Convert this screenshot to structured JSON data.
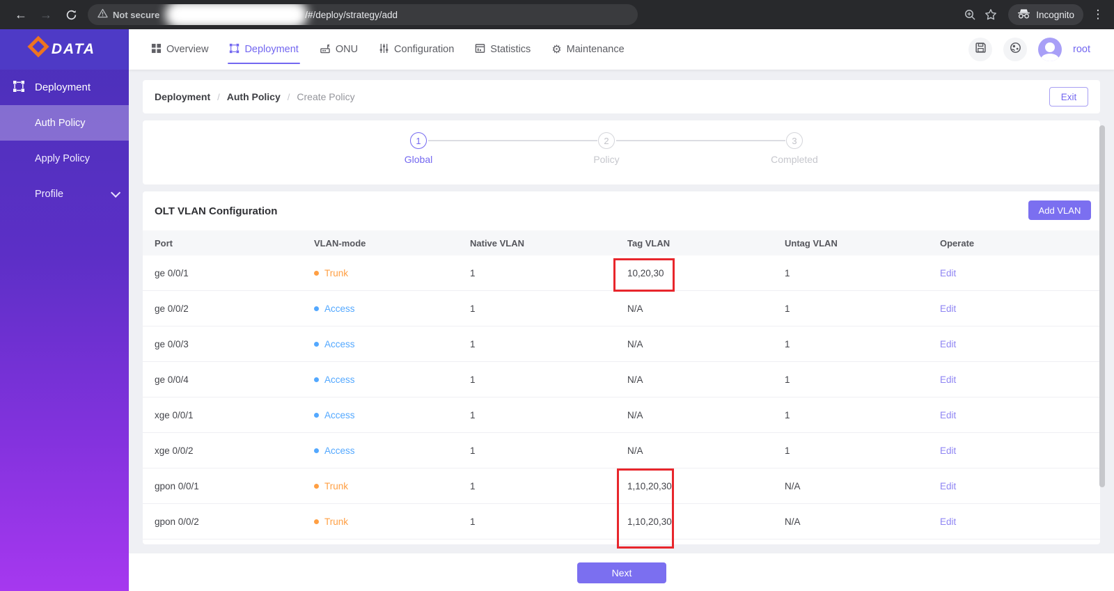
{
  "browser": {
    "security_label": "Not secure",
    "url_path": "/#/deploy/strategy/add",
    "incognito_label": "Incognito"
  },
  "brand": {
    "name": "DATA"
  },
  "nav": {
    "items": [
      {
        "label": "Overview",
        "icon": "grid",
        "active": false
      },
      {
        "label": "Deployment",
        "icon": "selection-frame",
        "active": true
      },
      {
        "label": "ONU",
        "icon": "device",
        "active": false
      },
      {
        "label": "Configuration",
        "icon": "sliders",
        "active": false
      },
      {
        "label": "Statistics",
        "icon": "chart-window",
        "active": false
      },
      {
        "label": "Maintenance",
        "icon": "gear",
        "active": false
      }
    ]
  },
  "user": {
    "name": "root"
  },
  "sidebar": {
    "section": {
      "label": "Deployment",
      "icon": "selection-frame"
    },
    "items": [
      {
        "label": "Auth Policy",
        "active": true
      },
      {
        "label": "Apply Policy",
        "active": false
      },
      {
        "label": "Profile",
        "active": false,
        "expandable": true
      }
    ]
  },
  "breadcrumb": {
    "items": [
      "Deployment",
      "Auth Policy",
      "Create Policy"
    ]
  },
  "exit_button": "Exit",
  "stepper": {
    "steps": [
      {
        "num": "1",
        "label": "Global",
        "state": "active"
      },
      {
        "num": "2",
        "label": "Policy",
        "state": "pending"
      },
      {
        "num": "3",
        "label": "Completed",
        "state": "pending"
      }
    ]
  },
  "vlan": {
    "title": "OLT VLAN Configuration",
    "add_button": "Add VLAN",
    "columns": [
      "Port",
      "VLAN-mode",
      "Native VLAN",
      "Tag VLAN",
      "Untag VLAN",
      "Operate"
    ],
    "rows": [
      {
        "port": "ge 0/0/1",
        "mode": "Trunk",
        "mode_type": "trunk",
        "native": "1",
        "tag": "10,20,30",
        "untag": "1",
        "operate": "Edit",
        "tag_highlighted": true
      },
      {
        "port": "ge 0/0/2",
        "mode": "Access",
        "mode_type": "access",
        "native": "1",
        "tag": "N/A",
        "untag": "1",
        "operate": "Edit",
        "tag_highlighted": false
      },
      {
        "port": "ge 0/0/3",
        "mode": "Access",
        "mode_type": "access",
        "native": "1",
        "tag": "N/A",
        "untag": "1",
        "operate": "Edit",
        "tag_highlighted": false
      },
      {
        "port": "ge 0/0/4",
        "mode": "Access",
        "mode_type": "access",
        "native": "1",
        "tag": "N/A",
        "untag": "1",
        "operate": "Edit",
        "tag_highlighted": false
      },
      {
        "port": "xge 0/0/1",
        "mode": "Access",
        "mode_type": "access",
        "native": "1",
        "tag": "N/A",
        "untag": "1",
        "operate": "Edit",
        "tag_highlighted": false
      },
      {
        "port": "xge 0/0/2",
        "mode": "Access",
        "mode_type": "access",
        "native": "1",
        "tag": "N/A",
        "untag": "1",
        "operate": "Edit",
        "tag_highlighted": false
      },
      {
        "port": "gpon 0/0/1",
        "mode": "Trunk",
        "mode_type": "trunk",
        "native": "1",
        "tag": "1,10,20,30",
        "untag": "N/A",
        "operate": "Edit",
        "tag_highlighted": true
      },
      {
        "port": "gpon 0/0/2",
        "mode": "Trunk",
        "mode_type": "trunk",
        "native": "1",
        "tag": "1,10,20,30",
        "untag": "N/A",
        "operate": "Edit",
        "tag_highlighted": true
      }
    ]
  },
  "next_button": "Next",
  "colors": {
    "accent": "#7367f0",
    "trunk_status": "#ff9f43",
    "access_status": "#53a8ff",
    "highlight_box": "#e8262c",
    "sidebar_top": "#4a31b9",
    "sidebar_bottom": "#a638ef",
    "logo_orange": "#ed7420"
  }
}
